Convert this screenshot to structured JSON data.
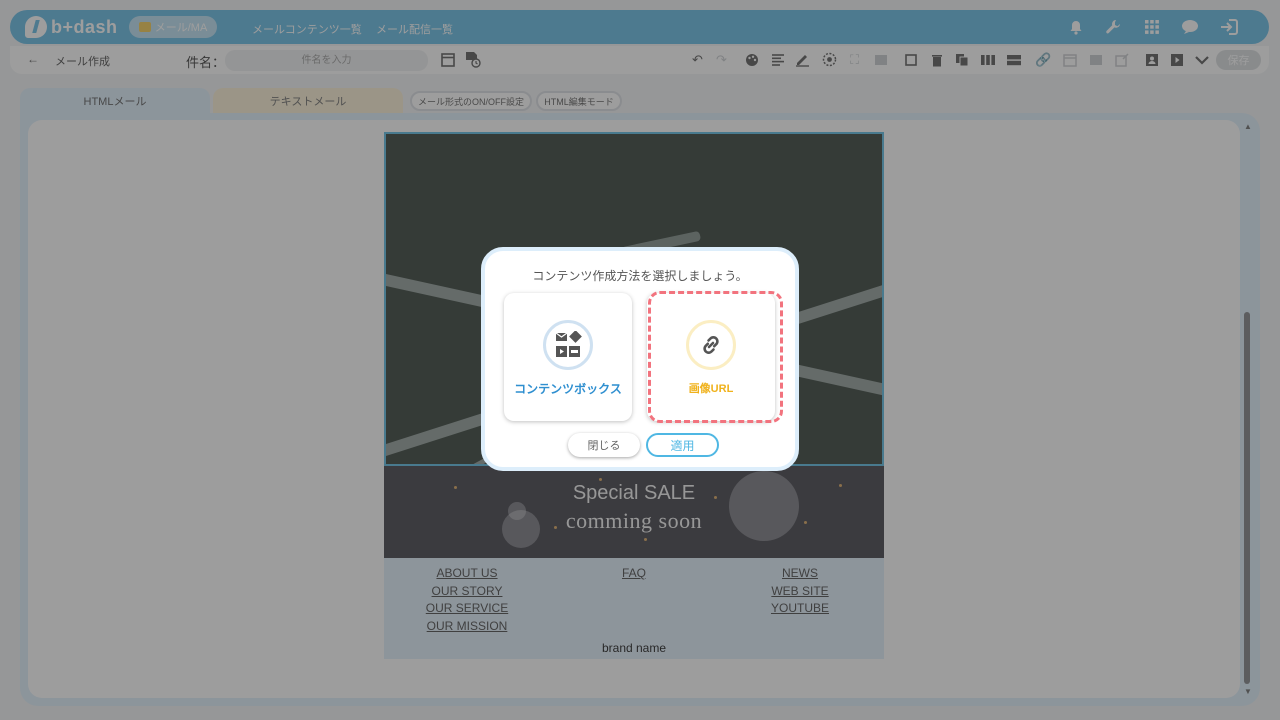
{
  "header": {
    "logo_text": "b+dash",
    "mode_label": "メール/MA",
    "nav": [
      "メールコンテンツ一覧",
      "メール配信一覧"
    ],
    "icons": [
      "bell-icon",
      "wrench-icon",
      "apps-grid-icon",
      "chat-icon",
      "logout-icon"
    ]
  },
  "toolbar": {
    "page_title": "メール作成",
    "subject_label": "件名：",
    "subject_placeholder": "件名を入力",
    "save_label": "保存"
  },
  "tabs": {
    "html": "HTMLメール",
    "text": "テキストメール",
    "toggle": "メール形式のON/OFF設定",
    "html_edit": "HTML編集モード"
  },
  "email": {
    "sale_title": "Special SALE",
    "sale_subtitle": "comming soon",
    "footer_col1": [
      "ABOUT US",
      "OUR STORY",
      "OUR SERVICE",
      "OUR MISSION"
    ],
    "footer_col2": [
      "FAQ"
    ],
    "footer_col3": [
      "NEWS",
      "WEB SITE",
      "YOUTUBE"
    ],
    "brand": "brand name"
  },
  "modal": {
    "title": "コンテンツ作成方法を選択しましょう。",
    "option_contents": "コンテンツボックス",
    "option_image_url": "画像URL",
    "close_label": "閉じる",
    "apply_label": "適用"
  },
  "colors": {
    "header_blue": "#5fb8e3",
    "accent_blue": "#2f8fd0",
    "accent_yellow": "#f0b21c",
    "highlight_red": "#f2737e"
  }
}
